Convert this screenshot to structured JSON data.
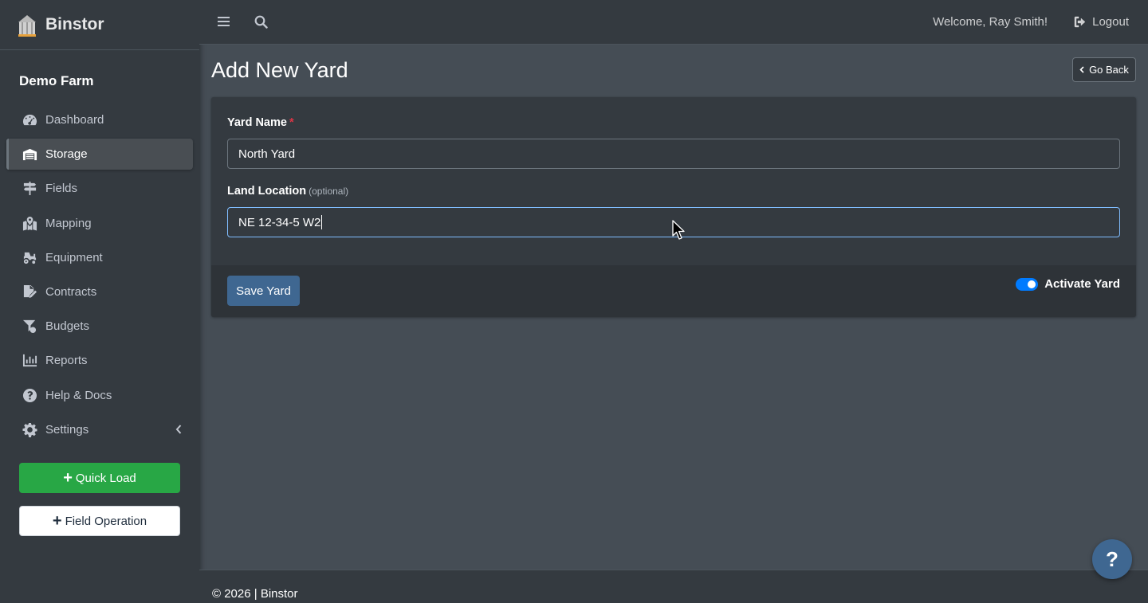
{
  "app": {
    "brand": "Binstor",
    "farm_name": "Demo Farm"
  },
  "topbar": {
    "menu_icon": "hamburger-icon",
    "search_icon": "search-icon",
    "welcome": "Welcome, Ray Smith!",
    "logout_label": "Logout"
  },
  "sidebar": {
    "items": [
      {
        "label": "Dashboard",
        "icon": "tachometer-icon",
        "active": false
      },
      {
        "label": "Storage",
        "icon": "warehouse-icon",
        "active": true
      },
      {
        "label": "Fields",
        "icon": "signs-icon",
        "active": false
      },
      {
        "label": "Mapping",
        "icon": "map-marked-icon",
        "active": false
      },
      {
        "label": "Equipment",
        "icon": "tractor-icon",
        "active": false
      },
      {
        "label": "Contracts",
        "icon": "file-signature-icon",
        "active": false
      },
      {
        "label": "Budgets",
        "icon": "funnel-dollar-icon",
        "active": false
      },
      {
        "label": "Reports",
        "icon": "chart-bar-icon",
        "active": false
      },
      {
        "label": "Help & Docs",
        "icon": "question-circle-icon",
        "active": false
      },
      {
        "label": "Settings",
        "icon": "cog-icon",
        "active": false
      }
    ],
    "quick_load_label": "Quick Load",
    "field_operation_label": "Field Operation"
  },
  "page": {
    "title": "Add New Yard",
    "go_back_label": "Go Back"
  },
  "form": {
    "yard_name_label": "Yard Name",
    "yard_name_required": "*",
    "yard_name_value": "North Yard",
    "land_location_label": "Land Location",
    "land_location_optional": "(optional)",
    "land_location_value": "NE 12-34-5 W2",
    "save_label": "Save Yard",
    "activate_label": "Activate Yard",
    "activate_on": true
  },
  "footer": {
    "text": "© 2026 | Binstor"
  },
  "help_fab": {
    "label": "?"
  },
  "colors": {
    "accent": "#3f6791",
    "success": "#28a745",
    "toggle": "#007bff",
    "required": "#dc3545"
  }
}
